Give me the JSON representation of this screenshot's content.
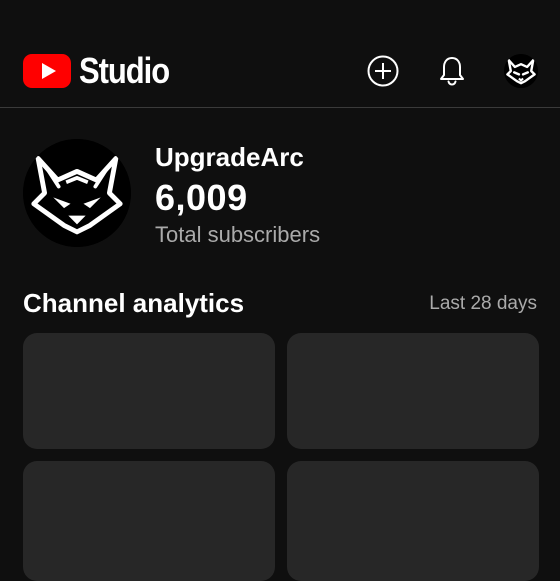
{
  "app_bar": {
    "logo_text": "Studio",
    "icons": [
      "create-icon",
      "notifications-bell-icon",
      "account-avatar-icon"
    ],
    "brand_color": "#ff0000"
  },
  "channel": {
    "name": "UpgradeArc",
    "subscriber_count": "6,009",
    "subscriber_label": "Total subscribers"
  },
  "analytics": {
    "title": "Channel analytics",
    "range": "Last 28 days",
    "cards": [
      {
        "id": "card-1"
      },
      {
        "id": "card-2"
      },
      {
        "id": "card-3"
      },
      {
        "id": "card-4"
      }
    ]
  },
  "colors": {
    "background": "#0f0f0f",
    "card": "#272727",
    "secondary_text": "#aaaaaa"
  }
}
